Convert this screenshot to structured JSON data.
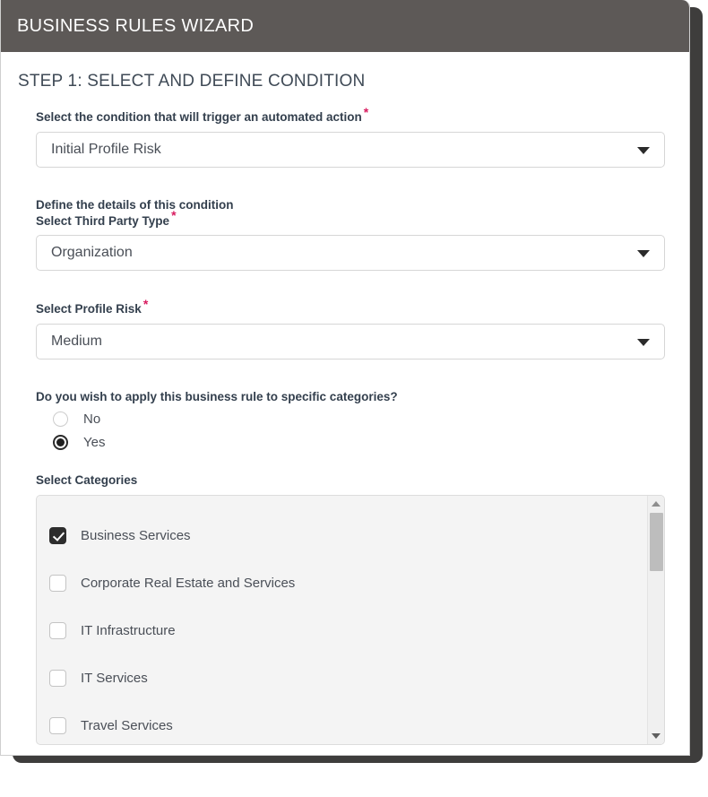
{
  "window": {
    "title": "BUSINESS RULES WIZARD"
  },
  "step": {
    "heading": "STEP 1: SELECT AND DEFINE CONDITION"
  },
  "condition": {
    "label": "Select the condition that will trigger an automated action",
    "required_marker": "*",
    "value": "Initial Profile Risk",
    "caret_icon": "chevron-down-icon"
  },
  "details": {
    "section_label": "Define the details of this condition",
    "third_party_type": {
      "label": "Select Third Party Type",
      "required_marker": "*",
      "value": "Organization"
    },
    "profile_risk": {
      "label": "Select Profile Risk",
      "required_marker": "*",
      "value": "Medium"
    }
  },
  "categories_question": {
    "label": "Do you wish to apply this business rule to specific categories?",
    "options": [
      {
        "label": "No",
        "selected": false
      },
      {
        "label": "Yes",
        "selected": true
      }
    ]
  },
  "categories": {
    "label": "Select Categories",
    "items": [
      {
        "label": "Business Services",
        "checked": true
      },
      {
        "label": "Corporate Real Estate and Services",
        "checked": false
      },
      {
        "label": "IT Infrastructure",
        "checked": false
      },
      {
        "label": "IT Services",
        "checked": false
      },
      {
        "label": "Travel Services",
        "checked": false
      }
    ],
    "scrollbar": {
      "up_icon": "scroll-up-arrow-icon",
      "down_icon": "scroll-down-arrow-icon"
    }
  },
  "colors": {
    "titlebar": "#5d5957",
    "required_star": "#d81b5f",
    "label_text": "#333f4d",
    "value_text": "#4a4f57",
    "panel_bg": "#f4f4f4",
    "checkbox_checked": "#2d2d2d"
  }
}
